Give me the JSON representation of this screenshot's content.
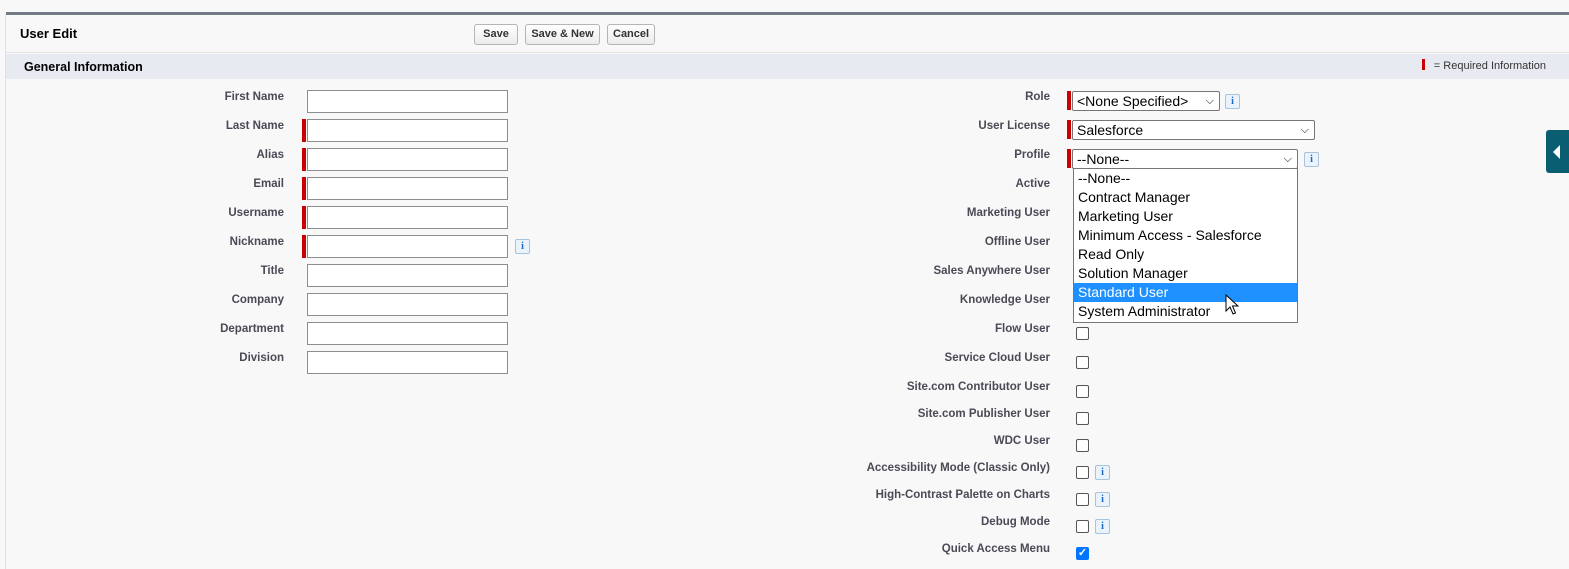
{
  "page": {
    "title": "User Edit",
    "buttons": {
      "save": "Save",
      "save_new": "Save & New",
      "cancel": "Cancel"
    }
  },
  "section": {
    "title": "General Information",
    "required_legend": "= Required Information"
  },
  "left_fields": [
    {
      "label": "First Name",
      "required": false
    },
    {
      "label": "Last Name",
      "required": true
    },
    {
      "label": "Alias",
      "required": true
    },
    {
      "label": "Email",
      "required": true
    },
    {
      "label": "Username",
      "required": true
    },
    {
      "label": "Nickname",
      "required": true
    },
    {
      "label": "Title",
      "required": false
    },
    {
      "label": "Company",
      "required": false
    },
    {
      "label": "Department",
      "required": false
    },
    {
      "label": "Division",
      "required": false
    }
  ],
  "right_fields": {
    "role": {
      "label": "Role",
      "value": "<None Specified>"
    },
    "user_license": {
      "label": "User License",
      "value": "Salesforce"
    },
    "profile": {
      "label": "Profile",
      "value": "--None--"
    },
    "active": {
      "label": "Active"
    },
    "marketing_user": {
      "label": "Marketing User"
    },
    "offline_user": {
      "label": "Offline User"
    },
    "sales_anywhere_user": {
      "label": "Sales Anywhere User"
    },
    "knowledge_user": {
      "label": "Knowledge User"
    },
    "flow_user": {
      "label": "Flow User",
      "checked": false
    },
    "service_cloud_user": {
      "label": "Service Cloud User",
      "checked": false
    },
    "sitecom_contributor_user": {
      "label": "Site.com Contributor User",
      "checked": false
    },
    "sitecom_publisher_user": {
      "label": "Site.com Publisher User",
      "checked": false
    },
    "wdc_user": {
      "label": "WDC User",
      "checked": false
    },
    "accessibility_mode": {
      "label": "Accessibility Mode (Classic Only)",
      "checked": false
    },
    "high_contrast": {
      "label": "High-Contrast Palette on Charts",
      "checked": false
    },
    "debug_mode": {
      "label": "Debug Mode",
      "checked": false
    },
    "quick_access_menu": {
      "label": "Quick Access Menu",
      "checked": true
    }
  },
  "profile_dropdown": {
    "options": [
      "--None--",
      "Contract Manager",
      "Marketing User",
      "Minimum Access - Salesforce",
      "Read Only",
      "Solution Manager",
      "Standard User",
      "System Administrator"
    ],
    "highlighted": "Standard User"
  },
  "icons": {
    "info": "info-icon",
    "chevron": "chevron-down-icon",
    "sidebar_toggle": "collapse-arrow-icon"
  },
  "colors": {
    "required": "#cc0000",
    "section_bg": "#e7ebf1",
    "highlight": "#1e90ff",
    "sidetab": "#0a5e72"
  }
}
